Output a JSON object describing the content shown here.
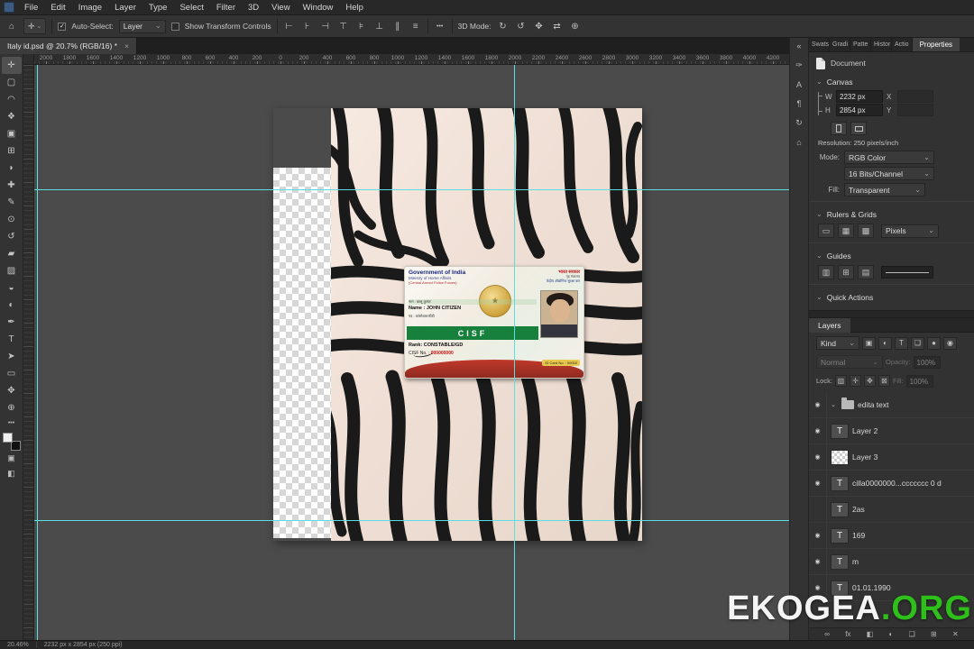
{
  "menu": {
    "items": [
      "File",
      "Edit",
      "Image",
      "Layer",
      "Type",
      "Select",
      "Filter",
      "3D",
      "View",
      "Window",
      "Help"
    ]
  },
  "options": {
    "auto_select_check": "✓",
    "auto_select_label": "Auto-Select:",
    "auto_select_value": "Layer",
    "show_transform_check": "",
    "show_transform_label": "Show Transform Controls",
    "more_label": "•••",
    "mode_3d_label": "3D Mode:",
    "align_icons": [
      {
        "name": "align-left-icon",
        "glyph": "⊢"
      },
      {
        "name": "align-center-h-icon",
        "glyph": "⊦"
      },
      {
        "name": "align-right-icon",
        "glyph": "⊣"
      },
      {
        "name": "align-top-icon",
        "glyph": "⊤"
      },
      {
        "name": "align-middle-icon",
        "glyph": "⊧"
      },
      {
        "name": "align-bottom-icon",
        "glyph": "⊥"
      },
      {
        "name": "distribute-h-icon",
        "glyph": "∥"
      },
      {
        "name": "distribute-v-icon",
        "glyph": "≡"
      }
    ],
    "mode_icons": [
      {
        "name": "3d-orbit-icon",
        "glyph": "↻"
      },
      {
        "name": "3d-roll-icon",
        "glyph": "↺"
      },
      {
        "name": "3d-drag-icon",
        "glyph": "✥"
      },
      {
        "name": "3d-slide-icon",
        "glyph": "⇄"
      },
      {
        "name": "3d-scale-icon",
        "glyph": "⊕"
      }
    ]
  },
  "doc_tab": {
    "title": "Italy id.psd @ 20.7% (RGB/16) *",
    "close": "×"
  },
  "ruler": {
    "labels": [
      "2000",
      "1800",
      "1600",
      "1400",
      "1200",
      "1000",
      "800",
      "600",
      "400",
      "200",
      "0",
      "200",
      "400",
      "600",
      "800",
      "1000",
      "1200",
      "1400",
      "1600",
      "1800",
      "2000",
      "2200",
      "2400",
      "2600",
      "2800",
      "3000",
      "3200",
      "3400",
      "3600",
      "3800",
      "4000",
      "4200"
    ]
  },
  "tools": [
    {
      "name": "move-tool",
      "glyph": "✛"
    },
    {
      "name": "marquee-tool",
      "glyph": "▢"
    },
    {
      "name": "lasso-tool",
      "glyph": "◠"
    },
    {
      "name": "quick-selection-tool",
      "glyph": "❖"
    },
    {
      "name": "crop-tool",
      "glyph": "▣"
    },
    {
      "name": "frame-tool",
      "glyph": "⊞"
    },
    {
      "name": "eyedropper-tool",
      "glyph": "◗"
    },
    {
      "name": "healing-brush-tool",
      "glyph": "✚"
    },
    {
      "name": "brush-tool",
      "glyph": "✎"
    },
    {
      "name": "clone-stamp-tool",
      "glyph": "⊙"
    },
    {
      "name": "history-brush-tool",
      "glyph": "↺"
    },
    {
      "name": "eraser-tool",
      "glyph": "▰"
    },
    {
      "name": "gradient-tool",
      "glyph": "▨"
    },
    {
      "name": "blur-tool",
      "glyph": "◒"
    },
    {
      "name": "dodge-tool",
      "glyph": "◐"
    },
    {
      "name": "pen-tool",
      "glyph": "✒"
    },
    {
      "name": "type-tool",
      "glyph": "T"
    },
    {
      "name": "path-selection-tool",
      "glyph": "➤"
    },
    {
      "name": "shape-tool",
      "glyph": "▭"
    },
    {
      "name": "hand-tool",
      "glyph": "✥"
    },
    {
      "name": "zoom-tool",
      "glyph": "⊕"
    }
  ],
  "panel_strip": [
    {
      "name": "collapse-panels-icon",
      "glyph": "«"
    },
    {
      "name": "brush-settings-icon",
      "glyph": "✑"
    },
    {
      "name": "character-panel-icon",
      "glyph": "A"
    },
    {
      "name": "paragraph-panel-icon",
      "glyph": "¶"
    },
    {
      "name": "history-panel-icon",
      "glyph": "↻"
    },
    {
      "name": "libraries-panel-icon",
      "glyph": "⌂"
    }
  ],
  "panel_tabs": {
    "small": [
      "Swats",
      "Gradi",
      "Patte",
      "Histor",
      "Actio"
    ],
    "active": "Properties"
  },
  "properties": {
    "document_label": "Document",
    "sections": {
      "canvas": "Canvas",
      "rulers_grids": "Rulers & Grids",
      "guides": "Guides",
      "quick_actions": "Quick Actions"
    },
    "w_label": "W",
    "w_value": "2232 px",
    "x_label": "X",
    "h_label": "H",
    "h_value": "2854 px",
    "y_label": "Y",
    "resolution_text": "Resolution: 250 pixels/inch",
    "mode_label": "Mode:",
    "mode_value": "RGB Color",
    "depth_value": "16 Bits/Channel",
    "fill_label": "Fill:",
    "fill_value": "Transparent",
    "units_value": "Pixels",
    "rg_icons": [
      {
        "name": "rulers-toggle-icon",
        "glyph": "▭"
      },
      {
        "name": "grid-toggle-icon",
        "glyph": "▦"
      },
      {
        "name": "snap-grid-icon",
        "glyph": "▩"
      }
    ],
    "guide_icons": [
      {
        "name": "add-guide-icon",
        "glyph": "▥"
      },
      {
        "name": "guide-layout-icon",
        "glyph": "⊞"
      },
      {
        "name": "lock-guides-icon",
        "glyph": "▤"
      }
    ]
  },
  "layers": {
    "tab": "Layers",
    "kind_value": "Kind",
    "filter_icons": [
      {
        "name": "filter-pixel-layers-icon",
        "glyph": "▣"
      },
      {
        "name": "filter-adjustment-layers-icon",
        "glyph": "◐"
      },
      {
        "name": "filter-type-layers-icon",
        "glyph": "T"
      },
      {
        "name": "filter-shape-layers-icon",
        "glyph": "❑"
      },
      {
        "name": "filter-smart-objects-icon",
        "glyph": "●"
      }
    ],
    "blend_value": "Normal",
    "opacity_label": "Opacity:",
    "opacity_value": "100%",
    "lock_label": "Lock:",
    "lock_icons": [
      {
        "name": "lock-transparency-icon",
        "glyph": "▨"
      },
      {
        "name": "lock-pixels-icon",
        "glyph": "✛"
      },
      {
        "name": "lock-position-icon",
        "glyph": "✥"
      },
      {
        "name": "lock-all-icon",
        "glyph": "⊠"
      }
    ],
    "fill_label": "Fill:",
    "fill_value": "100%",
    "rows": [
      {
        "name": "edita text",
        "kind": "group",
        "eye": true
      },
      {
        "name": "Layer 2",
        "kind": "text",
        "eye": true
      },
      {
        "name": "Layer 3",
        "kind": "image",
        "eye": true
      },
      {
        "name": "cilla0000000...ccccccc 0 d",
        "kind": "text",
        "eye": true
      },
      {
        "name": "2as",
        "kind": "text",
        "eye": false
      },
      {
        "name": "169",
        "kind": "text",
        "eye": true
      },
      {
        "name": "m",
        "kind": "text",
        "eye": true
      },
      {
        "name": "01.01.1990",
        "kind": "text",
        "eye": true
      }
    ],
    "bottom_icons": [
      {
        "name": "link-layers-icon",
        "glyph": "∞"
      },
      {
        "name": "layer-effects-icon",
        "glyph": "fx"
      },
      {
        "name": "layer-mask-icon",
        "glyph": "◧"
      },
      {
        "name": "adjustment-layer-icon",
        "glyph": "◐"
      },
      {
        "name": "layer-group-icon",
        "glyph": "❑"
      },
      {
        "name": "new-layer-icon",
        "glyph": "⊞"
      },
      {
        "name": "delete-layer-icon",
        "glyph": "✕"
      }
    ]
  },
  "status": {
    "zoom": "20.46%",
    "doc_info": "2232 px x 2854 px (250 ppi)"
  },
  "watermark": {
    "white": "EKOGEA",
    "green": ".ORG"
  },
  "id_card": {
    "gov_title": "Government of India",
    "ministry": "Ministry of Home Affairs",
    "force_en": "(Central Armed Police Forces)",
    "hindi_top": "भारत सरकार",
    "hindi_sub": "गृह मंत्रालय",
    "hindi_force": "केंद्रीय औद्योगिक सुरक्षा बल",
    "row1": "नाम : बब्लू कुमार",
    "name_line": "Name : JOHN CITIZEN",
    "row2": "पद : कांस्टेबल/जीडी",
    "band": "CISF",
    "rank_line": "Rank: CONSTABLE/GD",
    "cisf_label": "CISF No. :",
    "cisf_value": "000000000",
    "id_no": "ID Card No. : 00000"
  },
  "colors": {
    "guide": "#58e0e2",
    "watermark_green": "#2fbf1a",
    "band_green": "#17803c",
    "ribbon_red": "#b3392e",
    "accent_blue": "#1473e6"
  }
}
